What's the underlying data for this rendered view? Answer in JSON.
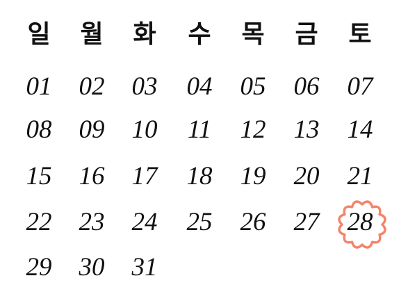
{
  "calendar": {
    "weekdays": [
      "일",
      "월",
      "화",
      "수",
      "목",
      "금",
      "토"
    ],
    "days": [
      "01",
      "02",
      "03",
      "04",
      "05",
      "06",
      "07",
      "08",
      "09",
      "10",
      "11",
      "12",
      "13",
      "14",
      "15",
      "16",
      "17",
      "18",
      "19",
      "20",
      "21",
      "22",
      "23",
      "24",
      "25",
      "26",
      "27",
      "28",
      "29",
      "30",
      "31"
    ],
    "highlighted_day": "28",
    "highlight_color": "#f4846a",
    "text_color": "#111111",
    "background_color": "#ffffff",
    "highlight_shape": "scalloped-circle-icon"
  }
}
